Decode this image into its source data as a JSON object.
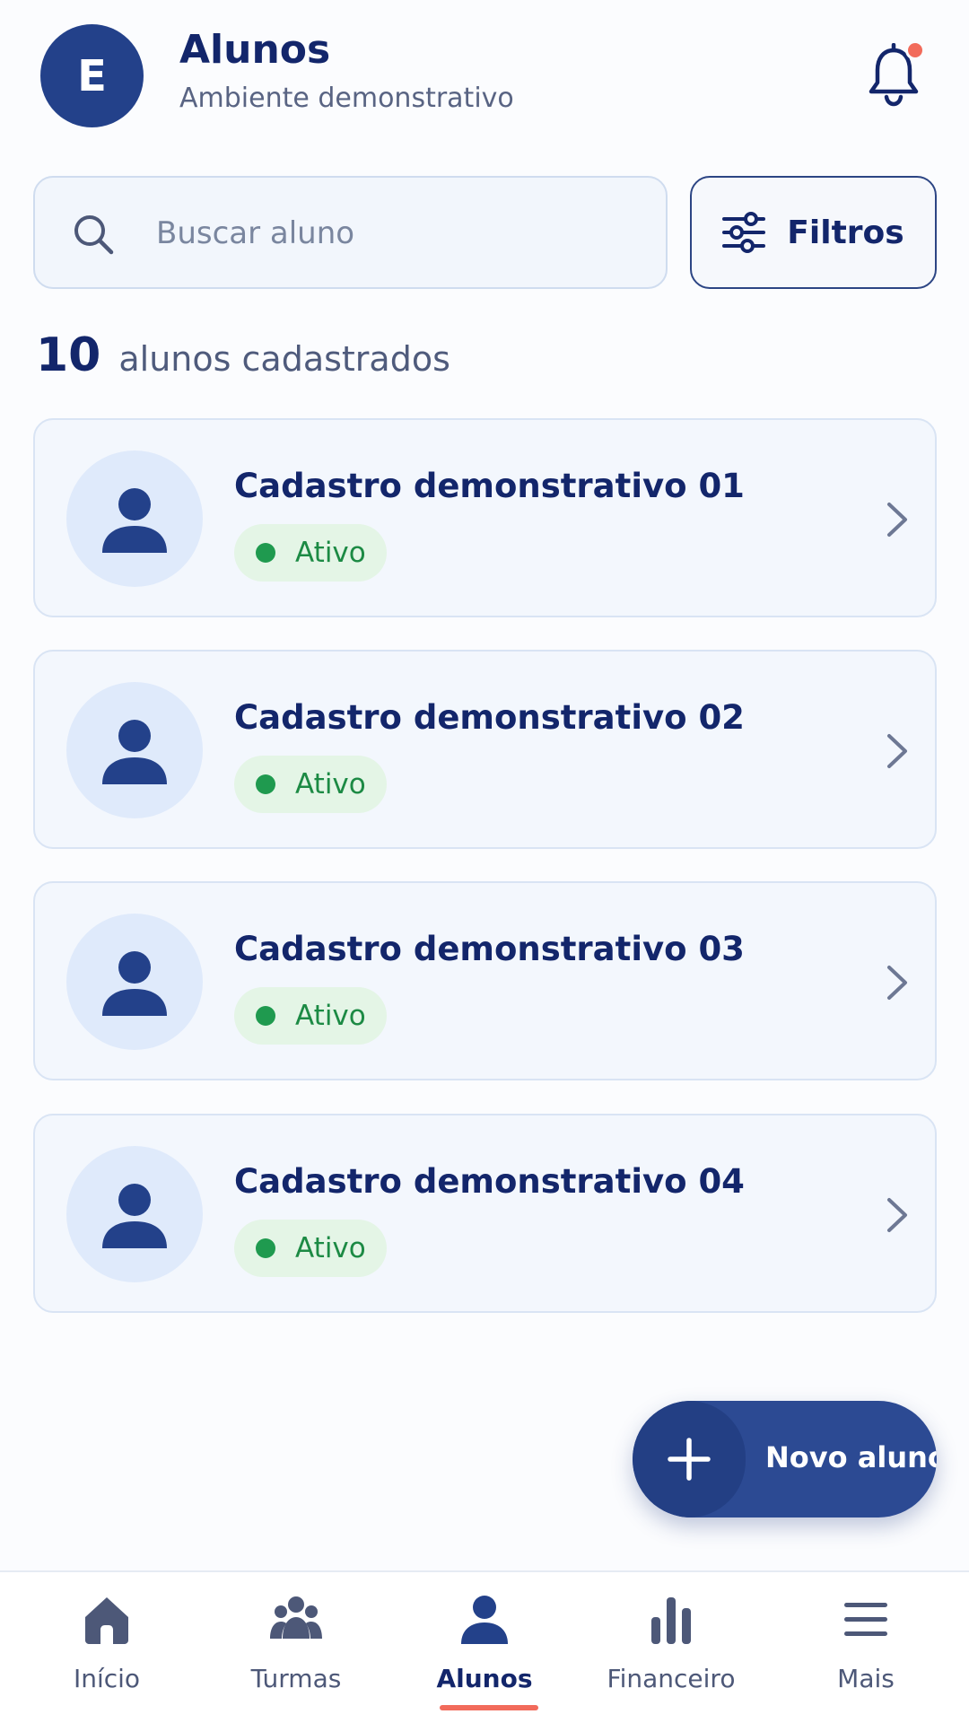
{
  "header": {
    "avatar_letter": "E",
    "title": "Alunos",
    "subtitle": "Ambiente demonstrativo",
    "notification_icon": "bell-icon",
    "has_notification_dot": true
  },
  "search": {
    "placeholder": "Buscar aluno",
    "value": "",
    "icon": "search-icon"
  },
  "filters": {
    "label": "Filtros",
    "icon": "sliders-icon"
  },
  "summary": {
    "count": "10",
    "label": "alunos cadastrados"
  },
  "students": [
    {
      "name": "Cadastro demonstrativo 01",
      "status": "Ativo"
    },
    {
      "name": "Cadastro demonstrativo 02",
      "status": "Ativo"
    },
    {
      "name": "Cadastro demonstrativo 03",
      "status": "Ativo"
    },
    {
      "name": "Cadastro demonstrativo 04",
      "status": "Ativo"
    }
  ],
  "fab": {
    "label": "Novo aluno",
    "icon": "plus-icon"
  },
  "bottom_nav": {
    "items": [
      {
        "label": "Início",
        "icon": "home-icon",
        "active": false
      },
      {
        "label": "Turmas",
        "icon": "group-icon",
        "active": false
      },
      {
        "label": "Alunos",
        "icon": "user-icon",
        "active": true
      },
      {
        "label": "Financeiro",
        "icon": "bar-chart-icon",
        "active": false
      },
      {
        "label": "Mais",
        "icon": "menu-icon",
        "active": false
      }
    ]
  },
  "colors": {
    "primary": "#23418a",
    "title": "#13266b",
    "status_active": "#1f9a4f",
    "status_bg": "#e4f5e6",
    "notification_dot": "#f26b5b",
    "nav_active_underline": "#f26b5b"
  }
}
